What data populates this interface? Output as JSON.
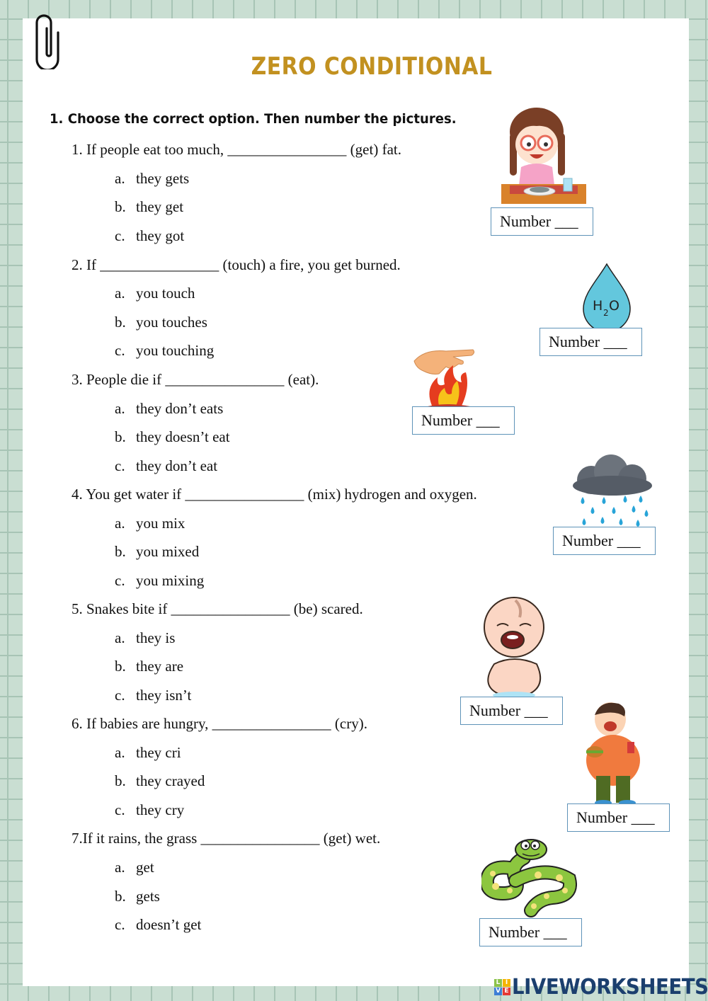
{
  "worksheet": {
    "title": "ZERO CONDITIONAL",
    "instruction": "1. Choose the correct option. Then number the pictures.",
    "questions": [
      {
        "text": "1. If people eat too much, ________________ (get) fat.",
        "options": [
          {
            "letter": "a.",
            "text": "they gets"
          },
          {
            "letter": "b.",
            "text": "they get"
          },
          {
            "letter": "c.",
            "text": "they got"
          }
        ]
      },
      {
        "text": "2. If ________________ (touch) a fire, you get burned.",
        "options": [
          {
            "letter": "a.",
            "text": "you touch"
          },
          {
            "letter": "b.",
            "text": "you touches"
          },
          {
            "letter": "c.",
            "text": "you touching"
          }
        ]
      },
      {
        "text": "3.  People die if ________________ (eat).",
        "options": [
          {
            "letter": "a.",
            "text": "they don’t eats"
          },
          {
            "letter": "b.",
            "text": "they doesn’t eat"
          },
          {
            "letter": "c.",
            "text": "they don’t eat"
          }
        ]
      },
      {
        "text": "4. You get water if ________________ (mix) hydrogen and oxygen.",
        "options": [
          {
            "letter": "a.",
            "text": "you mix"
          },
          {
            "letter": "b.",
            "text": "you mixed"
          },
          {
            "letter": "c.",
            "text": "you mixing"
          }
        ]
      },
      {
        "text": "5. Snakes bite if ________________ (be) scared.",
        "options": [
          {
            "letter": "a.",
            "text": "they is"
          },
          {
            "letter": "b.",
            "text": "they are"
          },
          {
            "letter": "c.",
            "text": "they isn’t"
          }
        ]
      },
      {
        "text": "6. If babies are hungry, ________________ (cry).",
        "options": [
          {
            "letter": "a.",
            "text": "they cri"
          },
          {
            "letter": "b.",
            "text": "they crayed"
          },
          {
            "letter": "c.",
            "text": "they cry"
          }
        ]
      },
      {
        "text": "7.If it rains, the grass ________________ (get) wet.",
        "options": [
          {
            "letter": "a.",
            "text": "get"
          },
          {
            "letter": "b.",
            "text": "gets"
          },
          {
            "letter": "c.",
            "text": "doesn’t get"
          }
        ]
      }
    ],
    "pictures": [
      {
        "icon": "girl-eating-fish-icon",
        "label": "Number ___"
      },
      {
        "icon": "water-drop-h2o-icon",
        "label": "Number ___",
        "drop_text": "H",
        "drop_sub": "2",
        "drop_text2": "O"
      },
      {
        "icon": "hand-touching-fire-icon",
        "label": "Number ___"
      },
      {
        "icon": "rain-cloud-icon",
        "label": "Number ___"
      },
      {
        "icon": "crying-baby-icon",
        "label": "Number ___"
      },
      {
        "icon": "fat-boy-eating-icon",
        "label": "Number ___"
      },
      {
        "icon": "snake-icon",
        "label": "Number ___"
      }
    ]
  },
  "branding": {
    "logo_letters": [
      "L",
      "I",
      "V",
      "E"
    ],
    "logo_text": "LIVEWORKSHEETS"
  },
  "colors": {
    "title": "#c29120",
    "background_grid": "#c9ded2",
    "box_border": "#5e93b8",
    "logo": "#1b3f6e"
  }
}
